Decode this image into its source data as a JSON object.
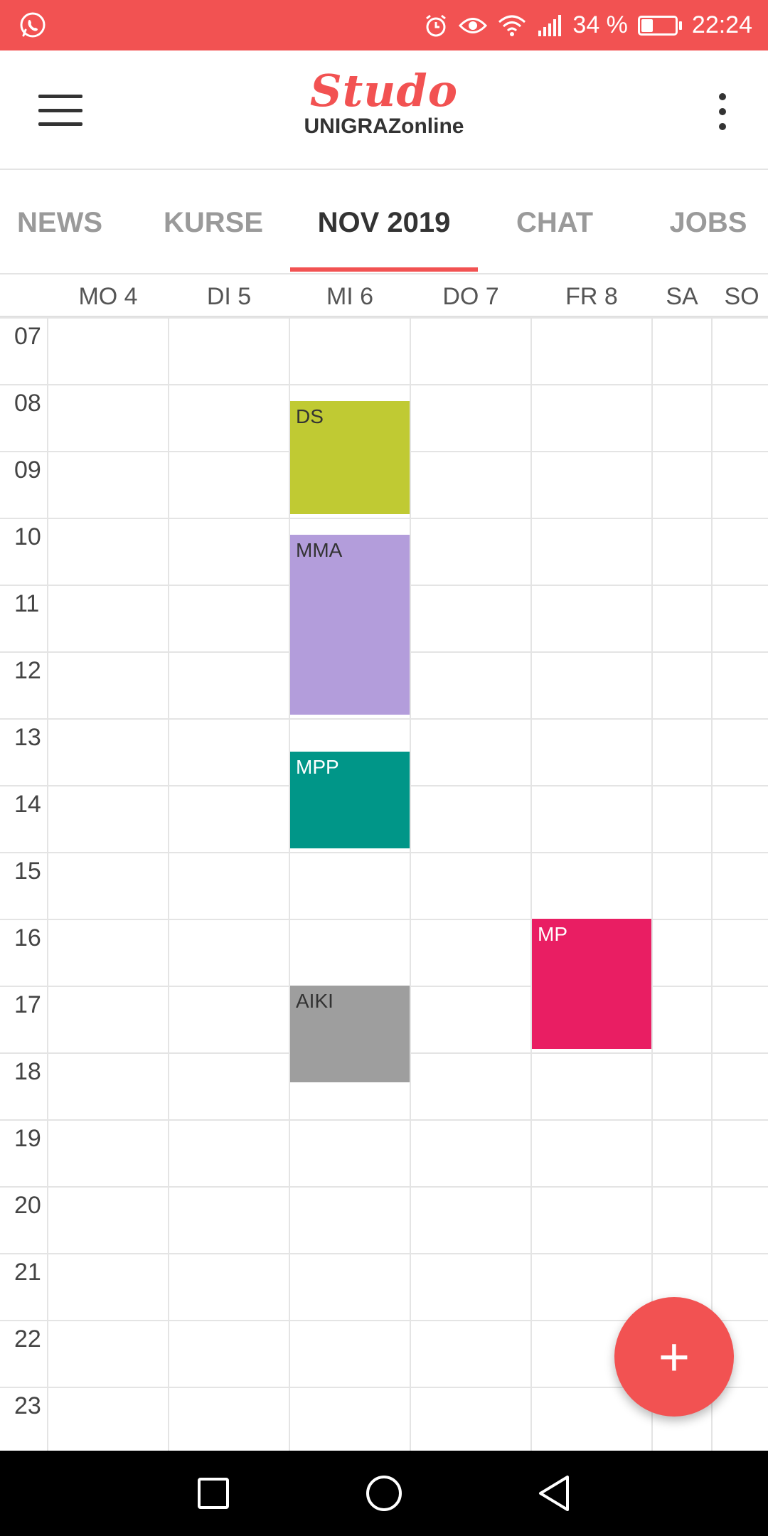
{
  "status_bar": {
    "battery": "34 %",
    "battery_level": 0.34,
    "time": "22:24",
    "icons": [
      "whatsapp-icon",
      "alarm-icon",
      "eye-icon",
      "wifi-icon",
      "signal-icon",
      "battery-icon"
    ]
  },
  "app_bar": {
    "logo": "Studo",
    "subtitle": "UNIGRAZonline"
  },
  "tabs": [
    {
      "label": "NEWS",
      "active": false
    },
    {
      "label": "KURSE",
      "active": false
    },
    {
      "label": "NOV 2019",
      "active": true
    },
    {
      "label": "CHAT",
      "active": false
    },
    {
      "label": "JOBS",
      "active": false
    }
  ],
  "days": [
    "MO 4",
    "DI 5",
    "MI 6",
    "DO 7",
    "FR 8",
    "SA",
    "SO"
  ],
  "hours": [
    "07",
    "08",
    "09",
    "10",
    "11",
    "12",
    "13",
    "14",
    "15",
    "16",
    "17",
    "18",
    "19",
    "20",
    "21",
    "22",
    "23"
  ],
  "events": [
    {
      "title": "DS",
      "day_index": 2,
      "start_hour": 8.25,
      "end_hour": 9.95,
      "color": "#c0ca33",
      "text_color": "#333333"
    },
    {
      "title": "MMA",
      "day_index": 2,
      "start_hour": 10.25,
      "end_hour": 12.95,
      "color": "#b39ddb",
      "text_color": "#333333"
    },
    {
      "title": "MPP",
      "day_index": 2,
      "start_hour": 13.5,
      "end_hour": 14.95,
      "color": "#009688",
      "text_color": "#ffffff"
    },
    {
      "title": "AIKI",
      "day_index": 2,
      "start_hour": 17.0,
      "end_hour": 18.45,
      "color": "#9e9e9e",
      "text_color": "#333333"
    },
    {
      "title": "MP",
      "day_index": 4,
      "start_hour": 16.0,
      "end_hour": 17.95,
      "color": "#e91e63",
      "text_color": "#ffffff"
    }
  ],
  "fab": {
    "label": "+"
  },
  "colors": {
    "accent": "#f25252",
    "grid_line": "#e4e4e4",
    "nav_background": "#000000"
  }
}
